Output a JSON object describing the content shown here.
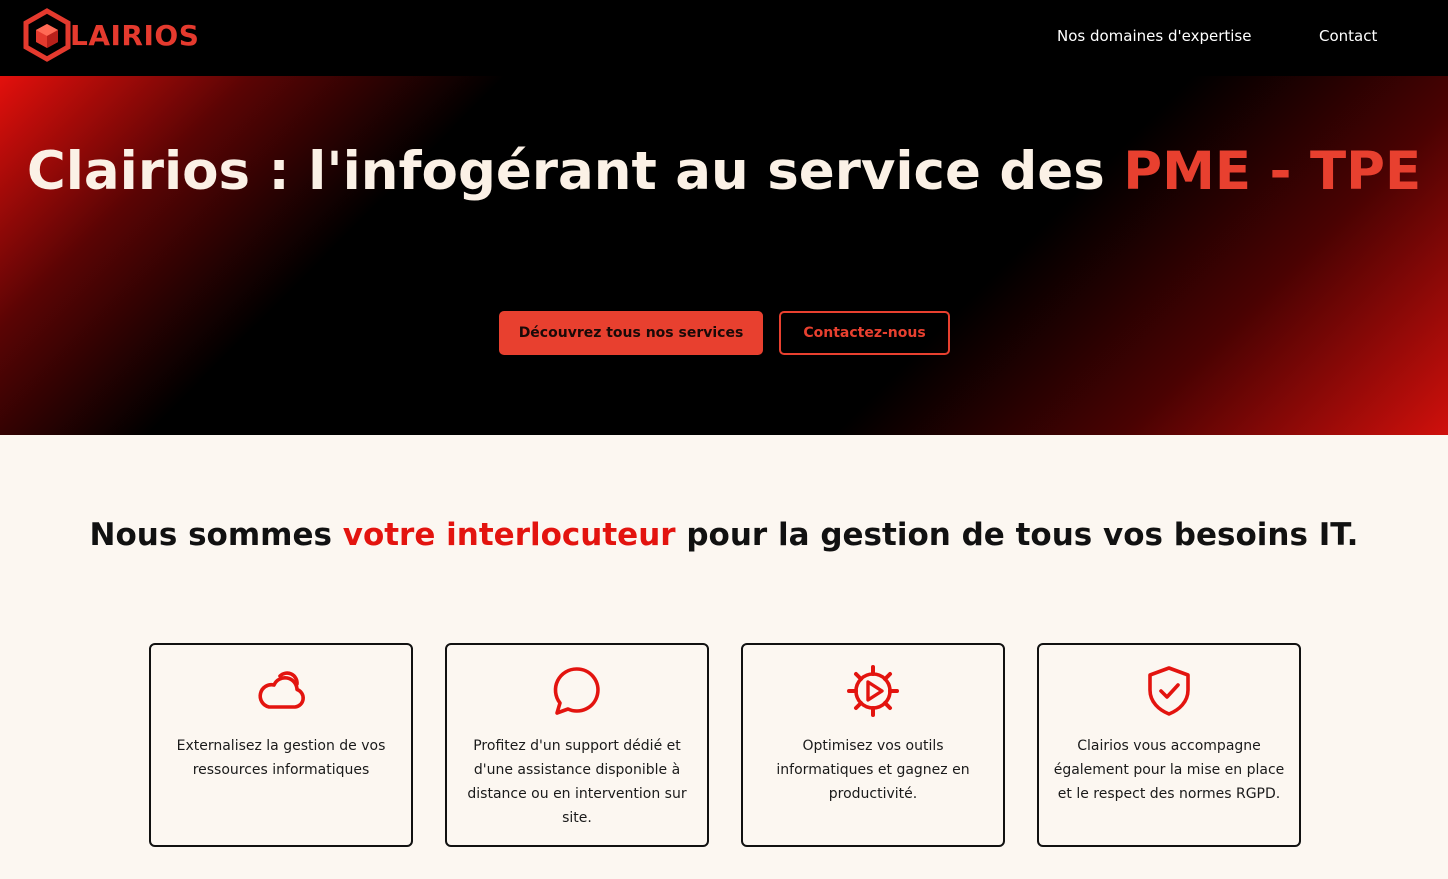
{
  "brand": {
    "name": "LAIRIOS",
    "accent_color": "#e8402f"
  },
  "nav": {
    "items": [
      {
        "label": "Nos domaines d'expertise"
      },
      {
        "label": "Contact"
      }
    ]
  },
  "hero": {
    "title_main": "Clairios : l'infogérant au service des ",
    "title_accent": "PME - TPE",
    "primary_button": "Découvrez tous nos services",
    "secondary_button": "Contactez-nous"
  },
  "intro": {
    "title_before": "Nous sommes ",
    "title_accent": "votre interlocuteur",
    "title_after": " pour la gestion de tous vos besoins IT."
  },
  "features": [
    {
      "icon": "cloud-icon",
      "text": "Externalisez la gestion de vos ressources informatiques"
    },
    {
      "icon": "chat-bubble-icon",
      "text": "Profitez d'un support dédié et d'une assistance disponible à distance ou en intervention sur site."
    },
    {
      "icon": "gear-play-icon",
      "text": "Optimisez vos outils informatiques et gagnez en productivité."
    },
    {
      "icon": "shield-check-icon",
      "text": "Clairios vous accompagne également pour la mise en place et le respect des normes RGPD."
    }
  ]
}
